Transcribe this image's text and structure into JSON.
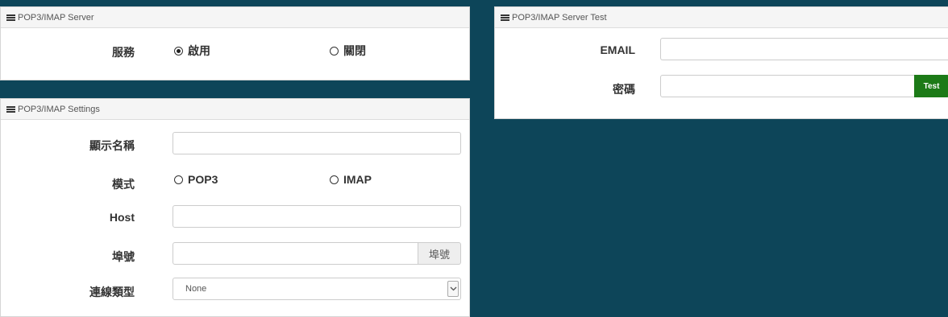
{
  "server_panel": {
    "title": "POP3/IMAP Server",
    "service_label": "服務",
    "options": [
      {
        "label": "啟用",
        "selected": true
      },
      {
        "label": "關閉",
        "selected": false
      }
    ]
  },
  "settings_panel": {
    "title": "POP3/IMAP Settings",
    "display_name_label": "顯示名稱",
    "display_name_value": "",
    "mode_label": "模式",
    "mode_options": [
      {
        "label": "POP3",
        "selected": false
      },
      {
        "label": "IMAP",
        "selected": false
      }
    ],
    "host_label": "Host",
    "host_value": "",
    "port_label": "埠號",
    "port_value": "",
    "port_addon": "埠號",
    "conn_type_label": "連線類型",
    "conn_type_value": "None"
  },
  "test_panel": {
    "title": "POP3/IMAP Server Test",
    "email_label": "EMAIL",
    "email_value": "",
    "password_label": "密碼",
    "password_value": "",
    "test_button": "Test"
  },
  "colors": {
    "background": "#0d4559",
    "test_button": "#1c7a17"
  }
}
